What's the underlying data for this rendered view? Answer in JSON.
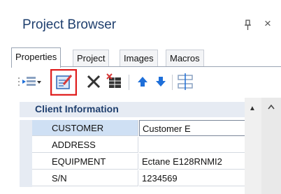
{
  "window": {
    "title": "Project Browser",
    "pin_icon": "pin-icon",
    "close_label": "×"
  },
  "tabs": [
    {
      "label": "Properties",
      "active": true
    },
    {
      "label": "Project",
      "active": false
    },
    {
      "label": "Images",
      "active": false
    },
    {
      "label": "Macros",
      "active": false
    }
  ],
  "toolbar": {
    "buttons": [
      {
        "name": "insert-row-icon"
      },
      {
        "name": "edit-icon",
        "highlighted": true
      },
      {
        "name": "delete-icon"
      },
      {
        "name": "delete-table-icon"
      },
      {
        "name": "move-up-icon"
      },
      {
        "name": "move-down-icon"
      },
      {
        "name": "split-icon"
      }
    ]
  },
  "grid": {
    "category": "Client Information",
    "rows": [
      {
        "name": "CUSTOMER",
        "value": "Customer E",
        "selected": true,
        "dropdown": true
      },
      {
        "name": "ADDRESS",
        "value": ""
      },
      {
        "name": "EQUIPMENT",
        "value": "Ectane E128RNMI2"
      },
      {
        "name": "S/N",
        "value": "1234569"
      }
    ]
  },
  "colors": {
    "title": "#1f3f6e",
    "highlight_border": "#e02020",
    "selected_row": "#cfe0f4"
  }
}
